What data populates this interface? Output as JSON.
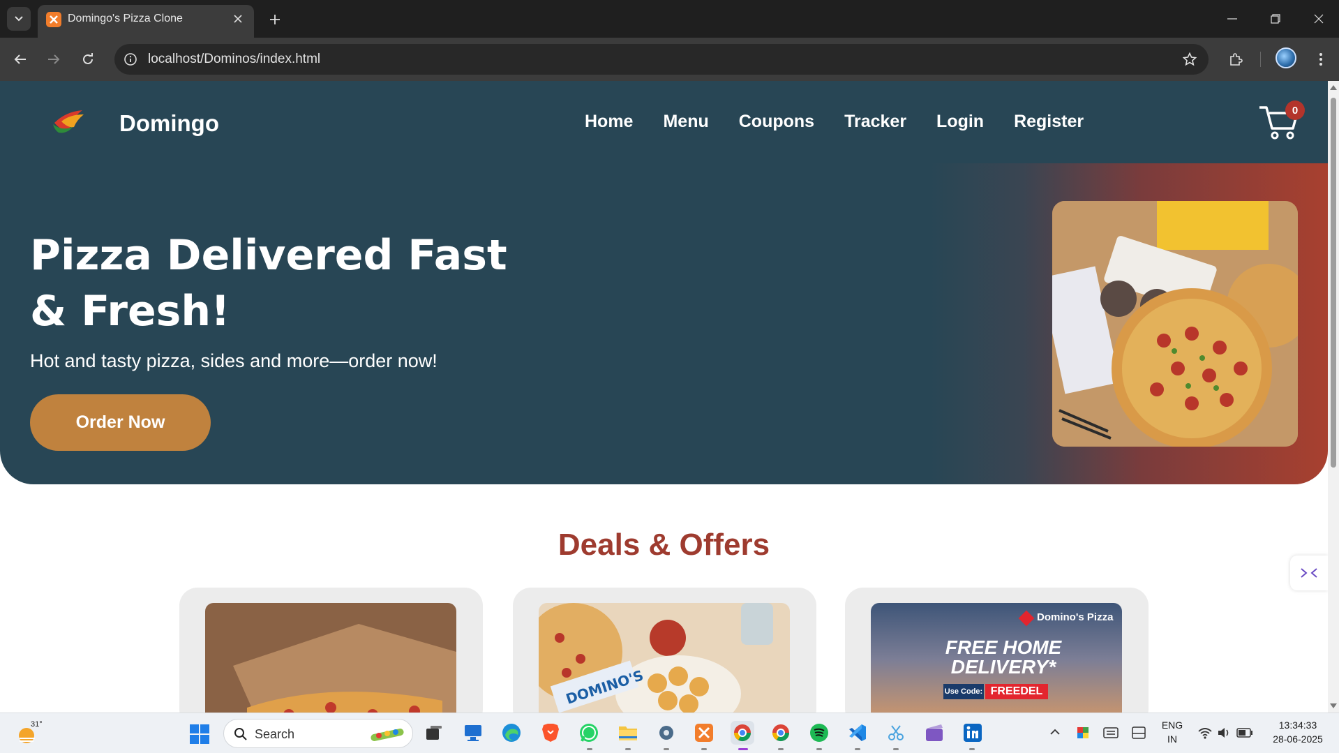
{
  "browser": {
    "tab_title": "Domingo's Pizza Clone",
    "url": "localhost/Dominos/index.html"
  },
  "site": {
    "brand": "Domingo",
    "nav": [
      "Home",
      "Menu",
      "Coupons",
      "Tracker",
      "Login",
      "Register"
    ],
    "cart_count": "0"
  },
  "hero": {
    "title": "Pizza Delivered Fast & Fresh!",
    "subtitle": "Hot and tasty pizza, sides and more—order now!",
    "cta": "Order Now"
  },
  "deals": {
    "title": "Deals & Offers",
    "cards": [
      {
        "image": "pizza-box-photo"
      },
      {
        "image": "sides-spread-photo",
        "text": "DOMINO'S"
      },
      {
        "image": "free-delivery-banner",
        "brand": "Domino's Pizza",
        "headline": "FREE HOME DELIVERY*",
        "code_label": "Use Code:",
        "code": "FREEDEL"
      }
    ]
  },
  "taskbar": {
    "temperature": "31°",
    "search_placeholder": "Search",
    "lang_top": "ENG",
    "lang_bottom": "IN",
    "time": "13:34:33",
    "date": "28-06-2025"
  },
  "colors": {
    "header_bg": "#284655",
    "accent_button": "#c0823e",
    "deals_title": "#9e3b2f",
    "cart_badge": "#b3342b"
  }
}
